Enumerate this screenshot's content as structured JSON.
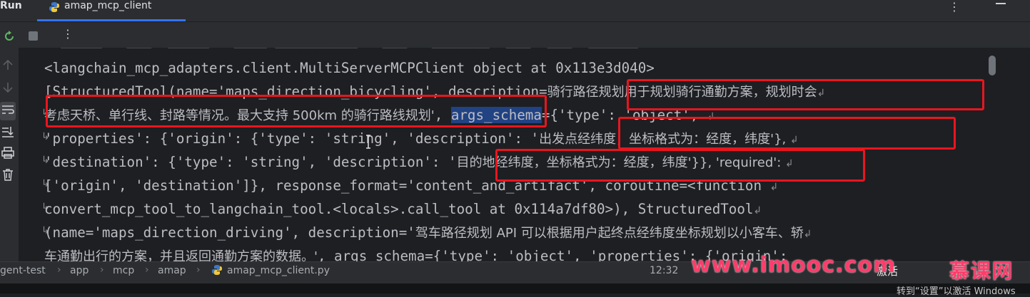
{
  "tool_window": {
    "title": "Run",
    "tab_label": "amap_mcp_client"
  },
  "code": {
    "line0": "<langchain_mcp_adapters.client.MultiServerMCPClient object at 0x113e3d040>",
    "line1_a": "[StructuredTool(name='maps_direction_bicycling', description=",
    "line1_b": "骑行路径规划用于规划骑行通勤方案，规划时会",
    "line2_a": "考虑天桥、单行线、封路等情况。最大支持 500km 的骑行路线规划'",
    "line2_b": ", ",
    "line2_c": "args_schema",
    "line2_d": "={'type': 'object', ",
    "line3_a": "'properties': {'origin': {'type': 'string', 'description': '",
    "line3_b": "出发点经纬度，坐标格式为：经度，纬度'}, ",
    "line4_a": "'destination': {'type': 'string', 'description': '",
    "line4_b": "目的地经纬度，坐标格式为：经度，纬度'}}, 'required': ",
    "line5": "['origin', 'destination']}, response_format='content_and_artifact', coroutine=<function ",
    "line6": "convert_mcp_tool_to_langchain_tool.<locals>.call_tool at 0x114a7df80>), StructuredTool",
    "line7_a": "(name='maps_direction_driving', description='",
    "line7_b": "驾车路径规划 API 可以根据用户起终点经纬度坐标规划以小客车、轿",
    "line8_a": "车通勤出行的方案，并且返回通勤方案的数据。'",
    "line8_b": ", args_schema={'type': 'object', 'properties': {'origin': "
  },
  "breadcrumb": [
    "gent-test",
    "app",
    "mcp",
    "amap",
    "amap_mcp_client.py"
  ],
  "status": {
    "time": "12:32",
    "activation_fragment": "激活"
  },
  "watermark": {
    "site": "www.imooc.com",
    "brand_cn": "慕课网",
    "windows_activation": "转到“设置”以激活 Windows"
  },
  "colors": {
    "background": "#1e1f22",
    "panel": "#2b2d30",
    "highlight_box": "#e8161f",
    "selection": "#214283",
    "tab_accent": "#3574f0"
  }
}
